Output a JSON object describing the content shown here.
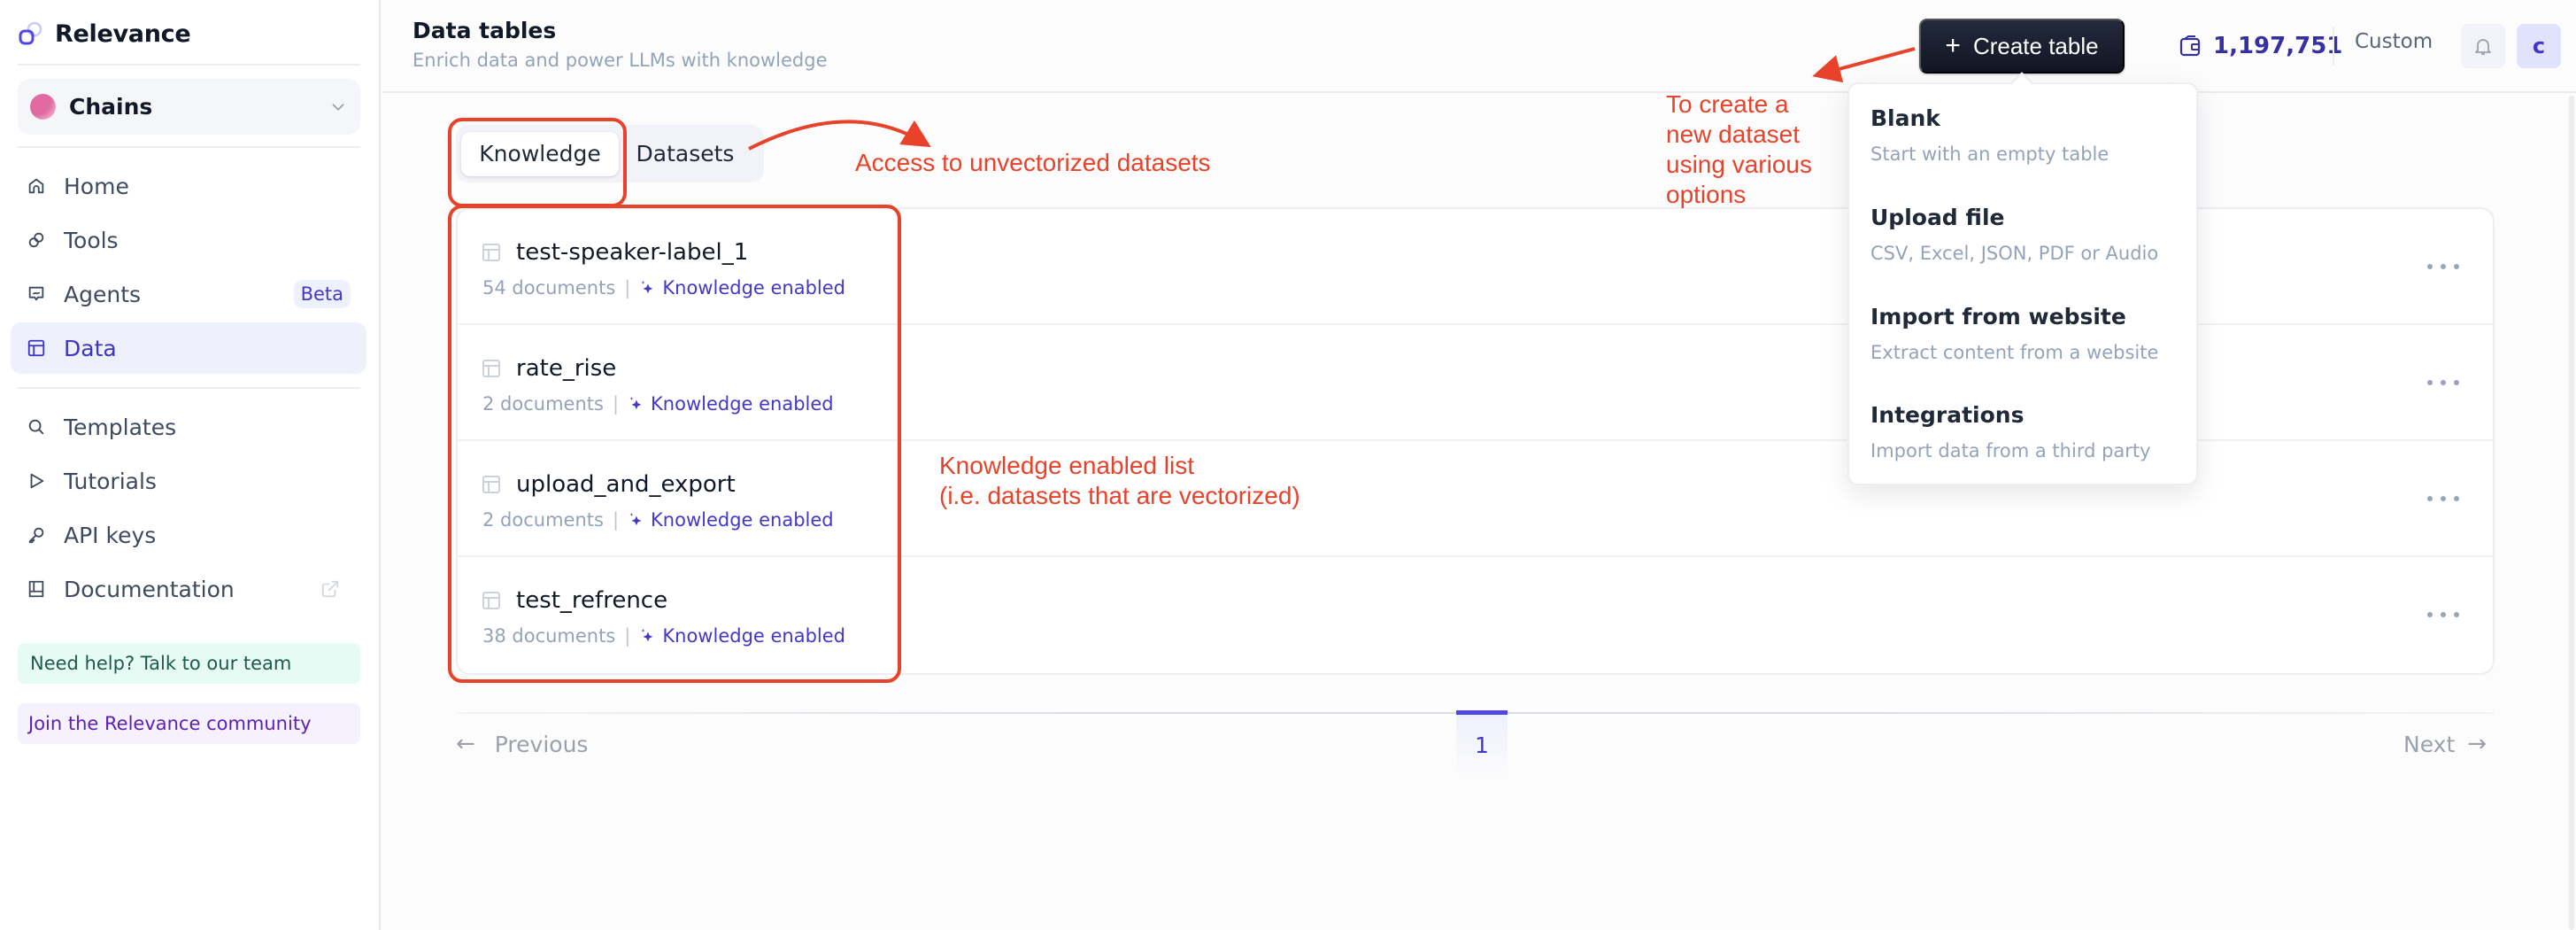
{
  "sidebar": {
    "brand": "Relevance",
    "workspace": "Chains",
    "nav": [
      {
        "label": "Home",
        "icon": "home-icon"
      },
      {
        "label": "Tools",
        "icon": "tools-icon"
      },
      {
        "label": "Agents",
        "icon": "agents-icon",
        "badge": "Beta"
      },
      {
        "label": "Data",
        "icon": "table-icon",
        "active": true
      }
    ],
    "nav2": [
      {
        "label": "Templates",
        "icon": "search-icon"
      },
      {
        "label": "Tutorials",
        "icon": "play-icon"
      },
      {
        "label": "API keys",
        "icon": "key-icon"
      },
      {
        "label": "Documentation",
        "icon": "book-icon",
        "external": true
      }
    ],
    "help": "Need help? Talk to our team",
    "community": "Join the Relevance community"
  },
  "header": {
    "title": "Data tables",
    "subtitle": "Enrich data and power LLMs with knowledge",
    "create_button": "Create table",
    "credits": "1,197,751",
    "plan": "Custom",
    "avatar_initial": "c"
  },
  "tabs": [
    {
      "label": "Knowledge",
      "active": true
    },
    {
      "label": "Datasets",
      "active": false
    }
  ],
  "tables": [
    {
      "name": "test-speaker-label_1",
      "documents": "54 documents",
      "status": "Knowledge enabled"
    },
    {
      "name": "rate_rise",
      "documents": "2 documents",
      "status": "Knowledge enabled"
    },
    {
      "name": "upload_and_export",
      "documents": "2 documents",
      "status": "Knowledge enabled"
    },
    {
      "name": "test_refrence",
      "documents": "38 documents",
      "status": "Knowledge enabled"
    }
  ],
  "pagination": {
    "previous": "Previous",
    "next": "Next",
    "current_page": "1"
  },
  "create_menu": [
    {
      "title": "Blank",
      "description": "Start with an empty table"
    },
    {
      "title": "Upload file",
      "description": "CSV, Excel, JSON, PDF or Audio"
    },
    {
      "title": "Import from website",
      "description": "Extract content from a website"
    },
    {
      "title": "Integrations",
      "description": "Import data from a third party"
    }
  ],
  "annotations": {
    "datasets_note": "Access to unvectorized datasets",
    "create_note": [
      "To create a",
      "new dataset",
      "using various",
      "options"
    ],
    "knowledge_note": [
      "Knowledge enabled list",
      "(i.e. datasets that are vectorized)"
    ]
  },
  "colors": {
    "accent": "#4338ca",
    "annotation": "#e8432a",
    "button_dark": "#121624"
  }
}
